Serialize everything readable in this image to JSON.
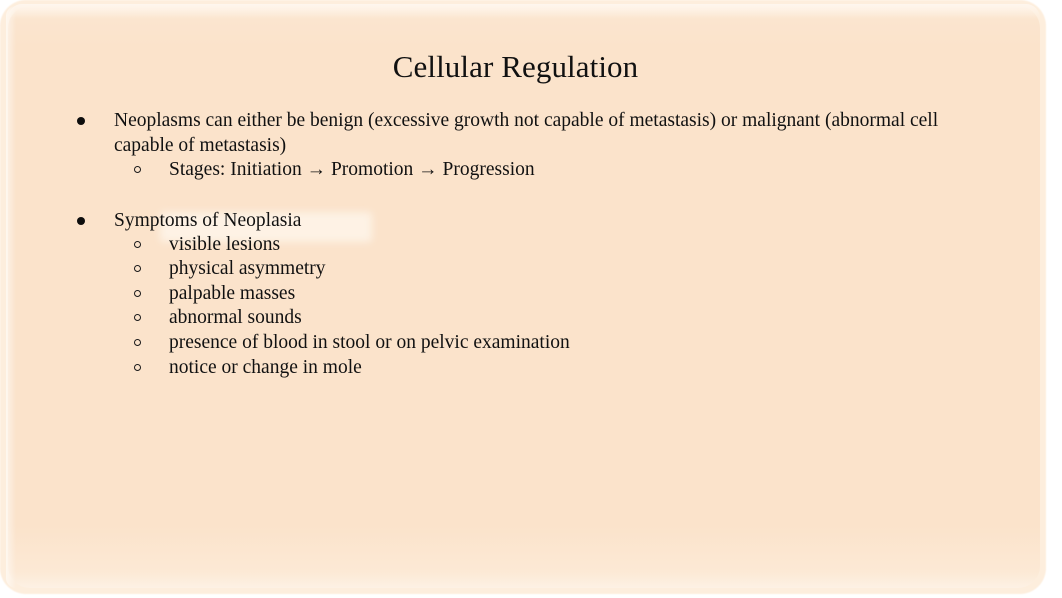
{
  "slide": {
    "title": "Cellular Regulation",
    "background_color": "#fbe3cb",
    "text_color": "#111111",
    "highlight_color": "#fffcf5",
    "bullets": [
      {
        "level": 1,
        "marker": "filled-disc",
        "text": "Neoplasms can either be benign (excessive growth not capable of metastasis) or malignant (abnormal cell capable of metastasis)",
        "children": [
          {
            "level": 2,
            "marker": "hollow-circle",
            "text": "Stages:  Initiation → Promotion → Progression"
          }
        ]
      },
      {
        "level": 1,
        "marker": "filled-disc",
        "text": "Symptoms of Neoplasia",
        "highlighted": true,
        "children": [
          {
            "level": 2,
            "marker": "hollow-circle",
            "text": "visible lesions"
          },
          {
            "level": 2,
            "marker": "hollow-circle",
            "text": "physical asymmetry"
          },
          {
            "level": 2,
            "marker": "hollow-circle",
            "text": "palpable masses"
          },
          {
            "level": 2,
            "marker": "hollow-circle",
            "text": "abnormal sounds"
          },
          {
            "level": 2,
            "marker": "hollow-circle",
            "text": "presence of blood in stool or on pelvic examination"
          },
          {
            "level": 2,
            "marker": "hollow-circle",
            "text": "notice or change in mole"
          }
        ]
      }
    ]
  }
}
